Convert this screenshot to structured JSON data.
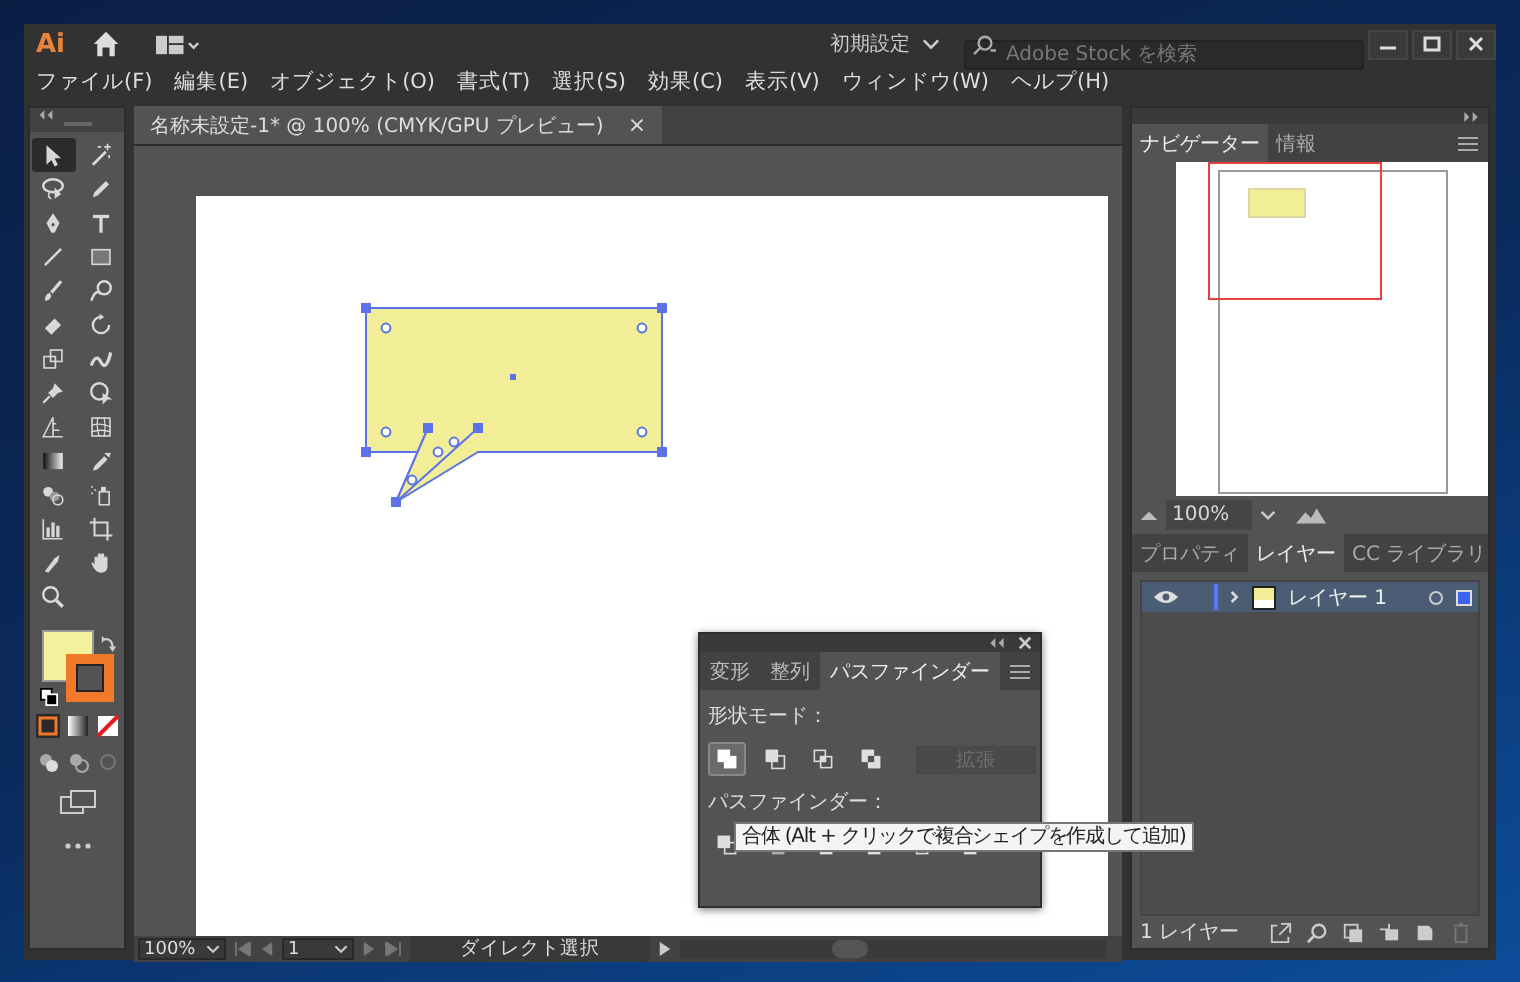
{
  "app": {
    "logo": "Ai",
    "workspace": "初期設定",
    "search_placeholder": "Adobe Stock を検索"
  },
  "menu": [
    "ファイル(F)",
    "編集(E)",
    "オブジェクト(O)",
    "書式(T)",
    "選択(S)",
    "効果(C)",
    "表示(V)",
    "ウィンドウ(W)",
    "ヘルプ(H)"
  ],
  "tools": [
    {
      "kind": "arrow",
      "selected": true
    },
    {
      "kind": "wand",
      "selected": false
    },
    {
      "kind": "lasso",
      "selected": false
    },
    {
      "kind": "pencil",
      "selected": false
    },
    {
      "kind": "pen",
      "selected": false
    },
    {
      "kind": "type",
      "selected": false
    },
    {
      "kind": "line",
      "selected": false
    },
    {
      "kind": "rect",
      "selected": false
    },
    {
      "kind": "brush",
      "selected": false
    },
    {
      "kind": "shaper",
      "selected": false
    },
    {
      "kind": "eraser",
      "selected": false
    },
    {
      "kind": "rotate",
      "selected": false
    },
    {
      "kind": "scale",
      "selected": false
    },
    {
      "kind": "warp",
      "selected": false
    },
    {
      "kind": "pin",
      "selected": false
    },
    {
      "kind": "builder",
      "selected": false
    },
    {
      "kind": "perspective",
      "selected": false
    },
    {
      "kind": "mesh",
      "selected": false
    },
    {
      "kind": "gradient",
      "selected": false
    },
    {
      "kind": "eyedropper",
      "selected": false
    },
    {
      "kind": "blend",
      "selected": false
    },
    {
      "kind": "spray",
      "selected": false
    },
    {
      "kind": "graph",
      "selected": false
    },
    {
      "kind": "artboard",
      "selected": false
    },
    {
      "kind": "slice",
      "selected": false
    },
    {
      "kind": "hand",
      "selected": false
    },
    {
      "kind": "zoom",
      "selected": false
    }
  ],
  "document": {
    "tab_title": "名称未設定-1* @ 100% (CMYK/GPU プレビュー)",
    "close": "×"
  },
  "pathfinder_panel": {
    "tabs": [
      {
        "label": "変形",
        "selected": false
      },
      {
        "label": "整列",
        "selected": false
      },
      {
        "label": "パスファインダー",
        "selected": true
      }
    ],
    "shape_modes_label": "形状モード：",
    "shape_modes": [
      {
        "kind": "unite",
        "hovered": true
      },
      {
        "kind": "minus",
        "hovered": false
      },
      {
        "kind": "intersect",
        "hovered": false
      },
      {
        "kind": "exclude",
        "hovered": false
      }
    ],
    "expand_button": {
      "label": "拡張",
      "disabled": true
    },
    "pathfinders_label": "パスファインダー：",
    "pathfinders": [
      {
        "kind": "divide"
      },
      {
        "kind": "trim"
      },
      {
        "kind": "merge"
      },
      {
        "kind": "crop"
      },
      {
        "kind": "outline"
      },
      {
        "kind": "minusback"
      }
    ],
    "tooltip": "合体 (Alt + クリックで複合シェイプを作成して追加)"
  },
  "status_bar": {
    "zoom": "100%",
    "artboard": "1",
    "tool": "ダイレクト選択"
  },
  "navigator": {
    "tabs": [
      {
        "label": "ナビゲーター",
        "selected": true
      },
      {
        "label": "情報",
        "selected": false
      }
    ],
    "zoom": "100%"
  },
  "layers_panel": {
    "tabs": [
      {
        "label": "プロパティ",
        "selected": false
      },
      {
        "label": "レイヤー",
        "selected": true
      },
      {
        "label": "CC ライブラリ",
        "selected": false
      }
    ],
    "layers": [
      {
        "name": "レイヤー 1",
        "visible": true,
        "selected": true
      }
    ],
    "footer": "1 レイヤー"
  }
}
